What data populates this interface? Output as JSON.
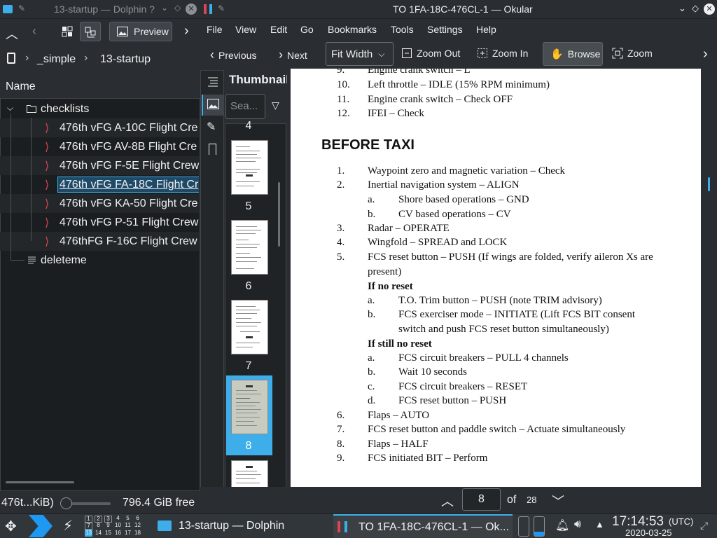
{
  "dolphin": {
    "window_title": "13-startup — Dolphin ?",
    "preview_label": "Preview",
    "breadcrumb": [
      "_simple",
      "13-startup"
    ],
    "column_header": "Name",
    "tree": [
      {
        "label": "checklists",
        "type": "folder",
        "expanded": true
      },
      {
        "label": "476th vFG A-10C Flight Cre",
        "type": "pdf"
      },
      {
        "label": "476th vFG AV-8B Flight Cre",
        "type": "pdf"
      },
      {
        "label": "476th vFG F-5E Flight Crew",
        "type": "pdf"
      },
      {
        "label": "476th vFG FA-18C Flight Cr",
        "type": "pdf",
        "selected": true
      },
      {
        "label": "476th vFG KA-50 Flight Cre",
        "type": "pdf"
      },
      {
        "label": "476th vFG P-51 Flight Crew",
        "type": "pdf"
      },
      {
        "label": "476thFG F-16C Flight Crew",
        "type": "pdf"
      },
      {
        "label": "deleteme",
        "type": "file"
      }
    ],
    "status_left": "476t...KiB)",
    "status_free": "796.4 GiB free"
  },
  "okular": {
    "window_title": "TO 1FA-18C-476CL-1 — Okular",
    "menu": [
      "File",
      "View",
      "Edit",
      "Go",
      "Bookmarks",
      "Tools",
      "Settings",
      "Help"
    ],
    "toolbar": {
      "previous": "Previous",
      "next": "Next",
      "zoom_select": "Fit Width",
      "zoom_out": "Zoom Out",
      "zoom_in": "Zoom In",
      "browse": "Browse",
      "zoom": "Zoom"
    },
    "sidebar_title": "Thumbnail",
    "search_placeholder": "Sea...",
    "thumb_numbers": [
      "4",
      "5",
      "6",
      "7",
      "8"
    ],
    "current_page": "8",
    "of_label": "of",
    "total_pages": "28"
  },
  "document": {
    "pre_items": [
      {
        "num": "9.",
        "text": "Engine crank switch – L"
      },
      {
        "num": "10.",
        "text": "Left throttle – IDLE (15% RPM minimum)"
      },
      {
        "num": "11.",
        "text": "Engine crank switch – Check OFF"
      },
      {
        "num": "12.",
        "text": "IFEI – Check"
      }
    ],
    "heading": "BEFORE TAXI",
    "items": {
      "i1": {
        "num": "1.",
        "text": "Waypoint zero and magnetic variation – Check"
      },
      "i2": {
        "num": "2.",
        "text": "Inertial navigation system – ALIGN"
      },
      "i2a": {
        "num": "a.",
        "text": "Shore based operations – GND"
      },
      "i2b": {
        "num": "b.",
        "text": "CV based operations – CV"
      },
      "i3": {
        "num": "3.",
        "text": "Radar – OPERATE"
      },
      "i4": {
        "num": "4.",
        "text": "Wingfold – SPREAD and LOCK"
      },
      "i5": {
        "num": "5.",
        "text": "FCS reset button – PUSH (If wings are folded, verify aileron Xs are",
        "text2": "present)"
      },
      "no_reset": "If no reset",
      "i5a": {
        "num": "a.",
        "text": "T.O. Trim button – PUSH (note TRIM advisory)"
      },
      "i5b": {
        "num": "b.",
        "text": "FCS exerciser mode – INITIATE (Lift FCS BIT consent",
        "text2": "switch and push FCS reset button simultaneously)"
      },
      "still_no_reset": "If still no reset",
      "j5a": {
        "num": "a.",
        "text": "FCS circuit breakers – PULL 4 channels"
      },
      "j5b": {
        "num": "b.",
        "text": "Wait 10 seconds"
      },
      "j5c": {
        "num": "c.",
        "text": "FCS circuit breakers – RESET"
      },
      "j5d": {
        "num": "d.",
        "text": "FCS reset button – PUSH"
      },
      "i6": {
        "num": "6.",
        "text": "Flaps – AUTO"
      },
      "i7": {
        "num": "7.",
        "text": "FCS reset button and paddle switch – Actuate simultaneously"
      },
      "i8": {
        "num": "8.",
        "text": "Flaps – HALF"
      },
      "i9": {
        "num": "9.",
        "text": "FCS initiated BIT – Perform"
      }
    }
  },
  "taskbar": {
    "pager": [
      "1",
      "2",
      "3",
      "4",
      "5",
      "6",
      "7",
      "8",
      "9",
      "10",
      "11",
      "12",
      "13",
      "14",
      "15",
      "16",
      "17",
      "18"
    ],
    "task_dolphin": "13-startup — Dolphin",
    "task_okular": "TO 1FA-18C-476CL-1 — Ok...",
    "time": "17:14:53",
    "tz": "(UTC)",
    "date": "2020-03-25"
  },
  "colors": {
    "accent": "#3daee9",
    "selection": "#1e4a68",
    "pdf_icon": "#da4453"
  }
}
